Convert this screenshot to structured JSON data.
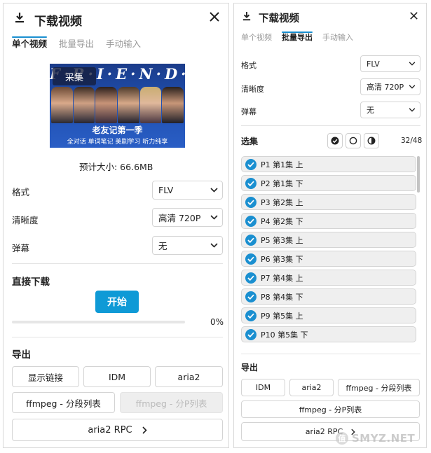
{
  "left": {
    "title": "下载视频",
    "tabs": [
      "单个视频",
      "批量导出",
      "手动输入"
    ],
    "active_tab": 0,
    "poster": {
      "logo": "F·R·I·E·N·D·S",
      "capture_label": "采集",
      "cn_title": "老友记第一季",
      "cn_subtitle": "全对话  单词笔记  美剧学习  听力纯享"
    },
    "estimated_size": "预计大小: 66.6MB",
    "format_label": "格式",
    "format_value": "FLV",
    "quality_label": "清晰度",
    "quality_value": "高清 720P",
    "danmaku_label": "弹幕",
    "danmaku_value": "无",
    "direct_download_title": "直接下载",
    "start_label": "开始",
    "progress_text": "0%",
    "progress_fraction": 0,
    "export_title": "导出",
    "export_buttons": [
      "显示链接",
      "IDM",
      "aria2",
      "ffmpeg - 分段列表",
      "ffmpeg - 分P列表"
    ],
    "rpc_label": "aria2 RPC"
  },
  "right": {
    "title": "下载视频",
    "tabs": [
      "单个视频",
      "批量导出",
      "手动输入"
    ],
    "active_tab": 1,
    "format_label": "格式",
    "format_value": "FLV",
    "quality_label": "清晰度",
    "quality_value": "高清 720P",
    "danmaku_label": "弹幕",
    "danmaku_value": "无",
    "select_title": "选集",
    "select_count": "32/48",
    "episodes": [
      "P1 第1集 上",
      "P2 第1集 下",
      "P3 第2集 上",
      "P4 第2集 下",
      "P5 第3集 上",
      "P6 第3集 下",
      "P7 第4集 上",
      "P8 第4集 下",
      "P9 第5集 上",
      "P10 第5集 下"
    ],
    "export_title": "导出",
    "export_buttons": [
      "IDM",
      "aria2",
      "ffmpeg - 分段列表",
      "ffmpeg - 分P列表"
    ],
    "rpc_label": "aria2 RPC"
  },
  "watermark": "SMYZ.NET",
  "colors": {
    "accent": "#0f9ad6",
    "tab_underline": "#1a8fd0",
    "check": "#1a8fd0"
  }
}
